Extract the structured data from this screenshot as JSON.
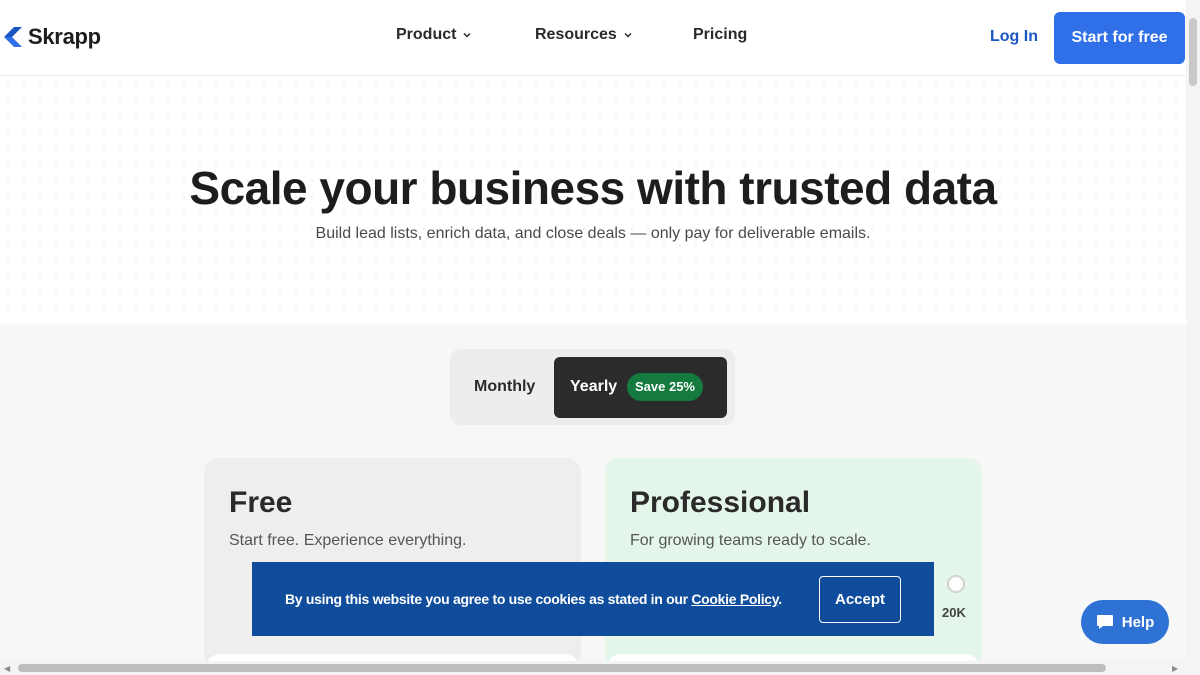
{
  "nav": {
    "brand": "Skrapp",
    "links": [
      {
        "label": "Product",
        "has_dropdown": true
      },
      {
        "label": "Resources",
        "has_dropdown": true
      },
      {
        "label": "Pricing",
        "has_dropdown": false
      }
    ],
    "login": "Log In",
    "cta": "Start for free"
  },
  "hero": {
    "title": "Scale your business with trusted data",
    "subtitle": "Build lead lists, enrich data, and close deals — only pay for deliverable emails."
  },
  "billing_toggle": {
    "monthly": "Monthly",
    "yearly": "Yearly",
    "yearly_badge": "Save 25%",
    "selected": "Yearly"
  },
  "plans": [
    {
      "name": "Free",
      "description": "Start free. Experience everything."
    },
    {
      "name": "Professional",
      "description": "For growing teams ready to scale.",
      "slider_max_label": "20K"
    }
  ],
  "cookie_banner": {
    "text": "By using this website you agree to use cookies as stated in our ",
    "link": "Cookie Policy",
    "suffix": ".",
    "accept": "Accept"
  },
  "help": {
    "label": "Help"
  },
  "colors": {
    "primary": "#2f6fe8",
    "login": "#1a56c4",
    "cookie_bg": "#0f4d9c",
    "badge_green": "#147a3d",
    "pro_card": "#e4f6e9"
  }
}
